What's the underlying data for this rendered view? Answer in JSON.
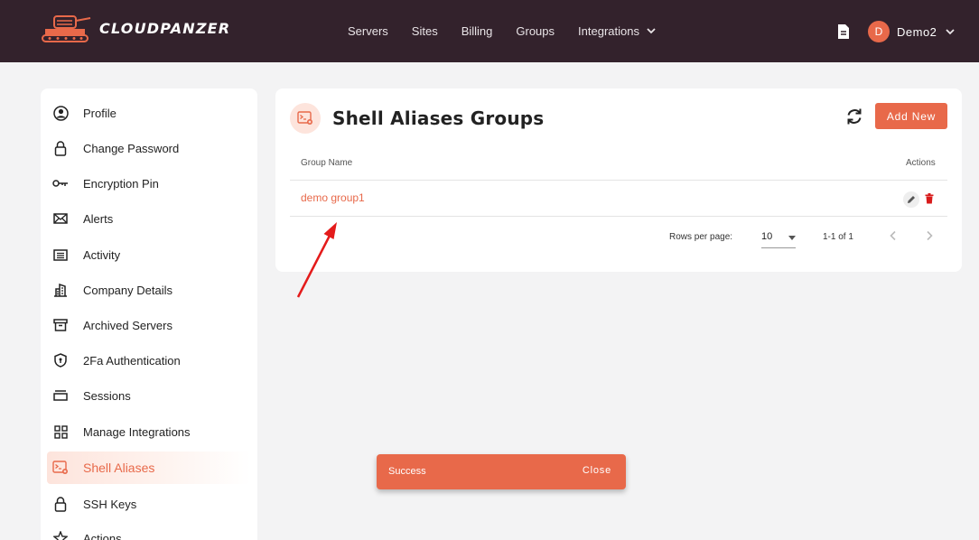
{
  "brand": {
    "name": "CLOUDPANZER"
  },
  "nav": {
    "items": [
      "Servers",
      "Sites",
      "Billing",
      "Groups",
      "Integrations"
    ]
  },
  "user": {
    "initial": "D",
    "name": "Demo2"
  },
  "sidebar": {
    "items": [
      {
        "label": "Profile",
        "icon": "user-circle-icon"
      },
      {
        "label": "Change Password",
        "icon": "lock-icon"
      },
      {
        "label": "Encryption Pin",
        "icon": "key-icon"
      },
      {
        "label": "Alerts",
        "icon": "mail-icon"
      },
      {
        "label": "Activity",
        "icon": "list-icon"
      },
      {
        "label": "Company Details",
        "icon": "building-icon"
      },
      {
        "label": "Archived Servers",
        "icon": "archive-icon"
      },
      {
        "label": "2Fa Authentication",
        "icon": "shield-icon"
      },
      {
        "label": "Sessions",
        "icon": "sessions-icon"
      },
      {
        "label": "Manage Integrations",
        "icon": "grid-icon"
      },
      {
        "label": "Shell Aliases",
        "icon": "terminal-icon",
        "active": true
      },
      {
        "label": "SSH Keys",
        "icon": "lock-icon"
      },
      {
        "label": "Actions",
        "icon": "star-icon"
      }
    ]
  },
  "main": {
    "title": "Shell Aliases Groups",
    "add_label": "Add New",
    "table": {
      "headers": {
        "name": "Group Name",
        "actions": "Actions"
      },
      "rows": [
        {
          "name": "demo group1"
        }
      ]
    },
    "pagination": {
      "rows_per_page_label": "Rows per page:",
      "rows_per_page": "10",
      "range": "1-1 of 1"
    }
  },
  "toast": {
    "message": "Success",
    "close_label": "Close"
  },
  "colors": {
    "accent": "#e8694a",
    "topbar": "#33222c",
    "background": "#f3f3f4"
  }
}
